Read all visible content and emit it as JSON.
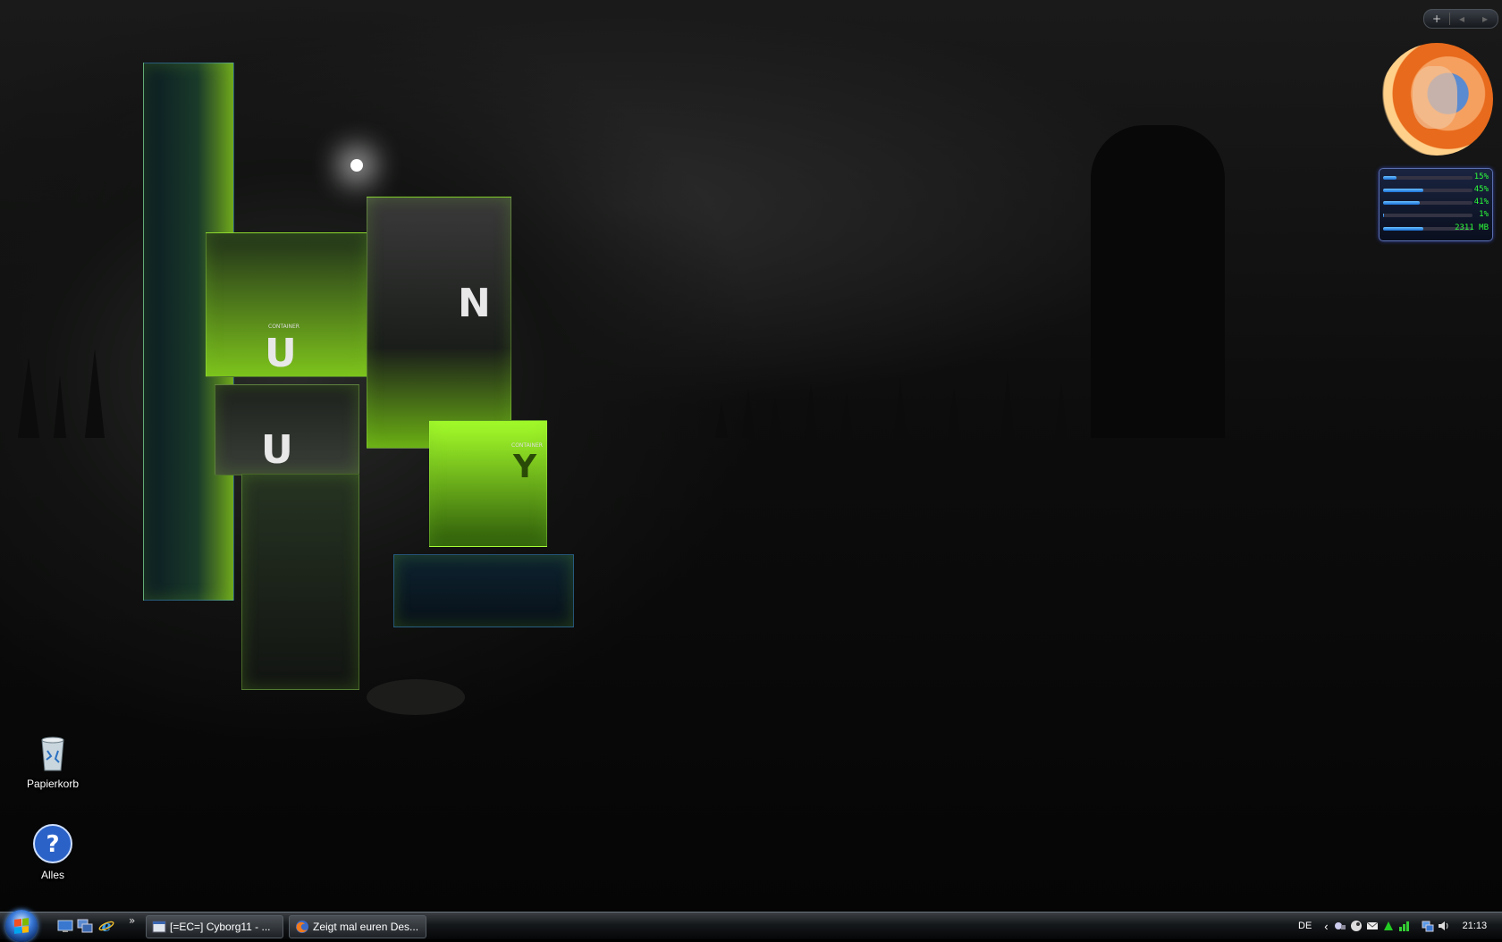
{
  "desktop": {
    "icons": [
      {
        "label": "Papierkorb",
        "icon": "recycle-bin-icon"
      },
      {
        "label": "Alles",
        "icon": "help-icon"
      }
    ],
    "wallpaper_letters": [
      "U",
      "N",
      "U",
      "Y"
    ],
    "wallpaper_caption": "CONTAINER"
  },
  "sidebar": {
    "add_label": "+",
    "prev_label": "◂",
    "next_label": "▸",
    "meter": [
      {
        "value": "15%",
        "level": 0.15
      },
      {
        "value": "45%",
        "level": 0.45
      },
      {
        "value": "41%",
        "level": 0.41
      },
      {
        "value": "1%",
        "level": 0.01
      },
      {
        "value": "2311 MB",
        "level": 0.45
      }
    ]
  },
  "taskbar": {
    "chevron": "»",
    "buttons": [
      {
        "label": "[=EC=] Cyborg11 - ...",
        "icon": "window-icon"
      },
      {
        "label": "Zeigt mal euren Des...",
        "icon": "firefox-icon"
      }
    ],
    "language": "DE",
    "tray_arrow": "‹",
    "clock": "21:13"
  },
  "colors": {
    "accent_green": "#9cff2a",
    "meter_text": "#2cff3a",
    "taskbar_top": "#3b3f44"
  }
}
